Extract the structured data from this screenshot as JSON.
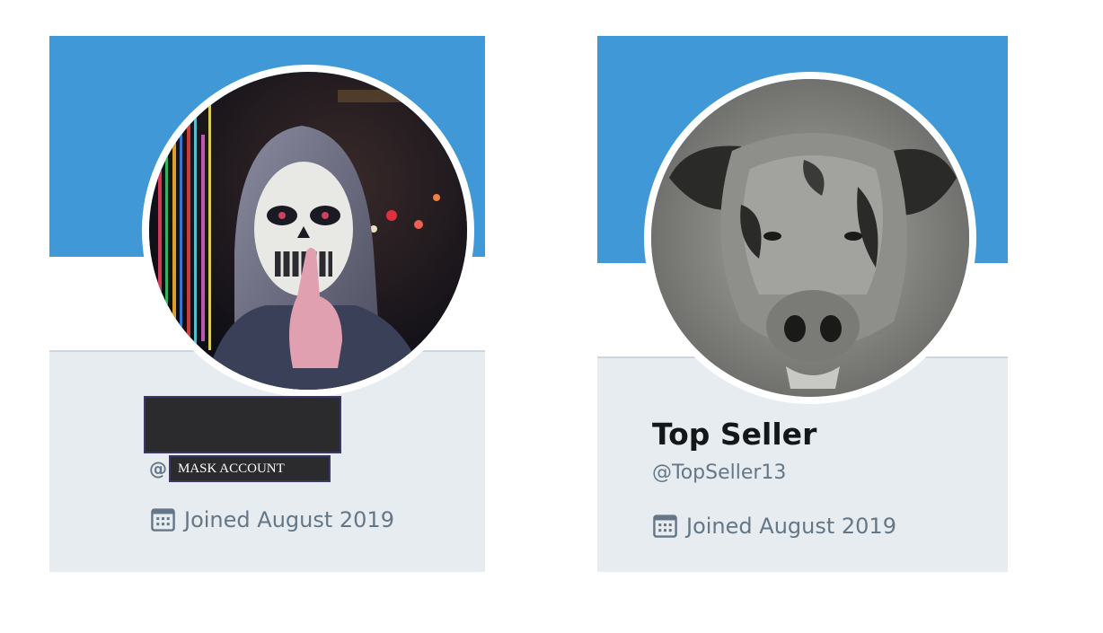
{
  "profiles": [
    {
      "display_name": "",
      "handle_prefix": "@",
      "redaction_label": "MASK ACCOUNT",
      "joined": "Joined August 2019",
      "avatar": "hooded-skull-mask-person"
    },
    {
      "display_name": "Top Seller",
      "handle": "@TopSeller13",
      "joined": "Joined August 2019",
      "avatar": "pig-head-mask"
    }
  ],
  "colors": {
    "banner": "#4099d6",
    "card_background": "#e6ecf0",
    "muted_text": "#657786",
    "name_text": "#14171a",
    "redaction_fill": "#2b2a2d"
  },
  "icons": {
    "joined": "calendar-icon"
  }
}
